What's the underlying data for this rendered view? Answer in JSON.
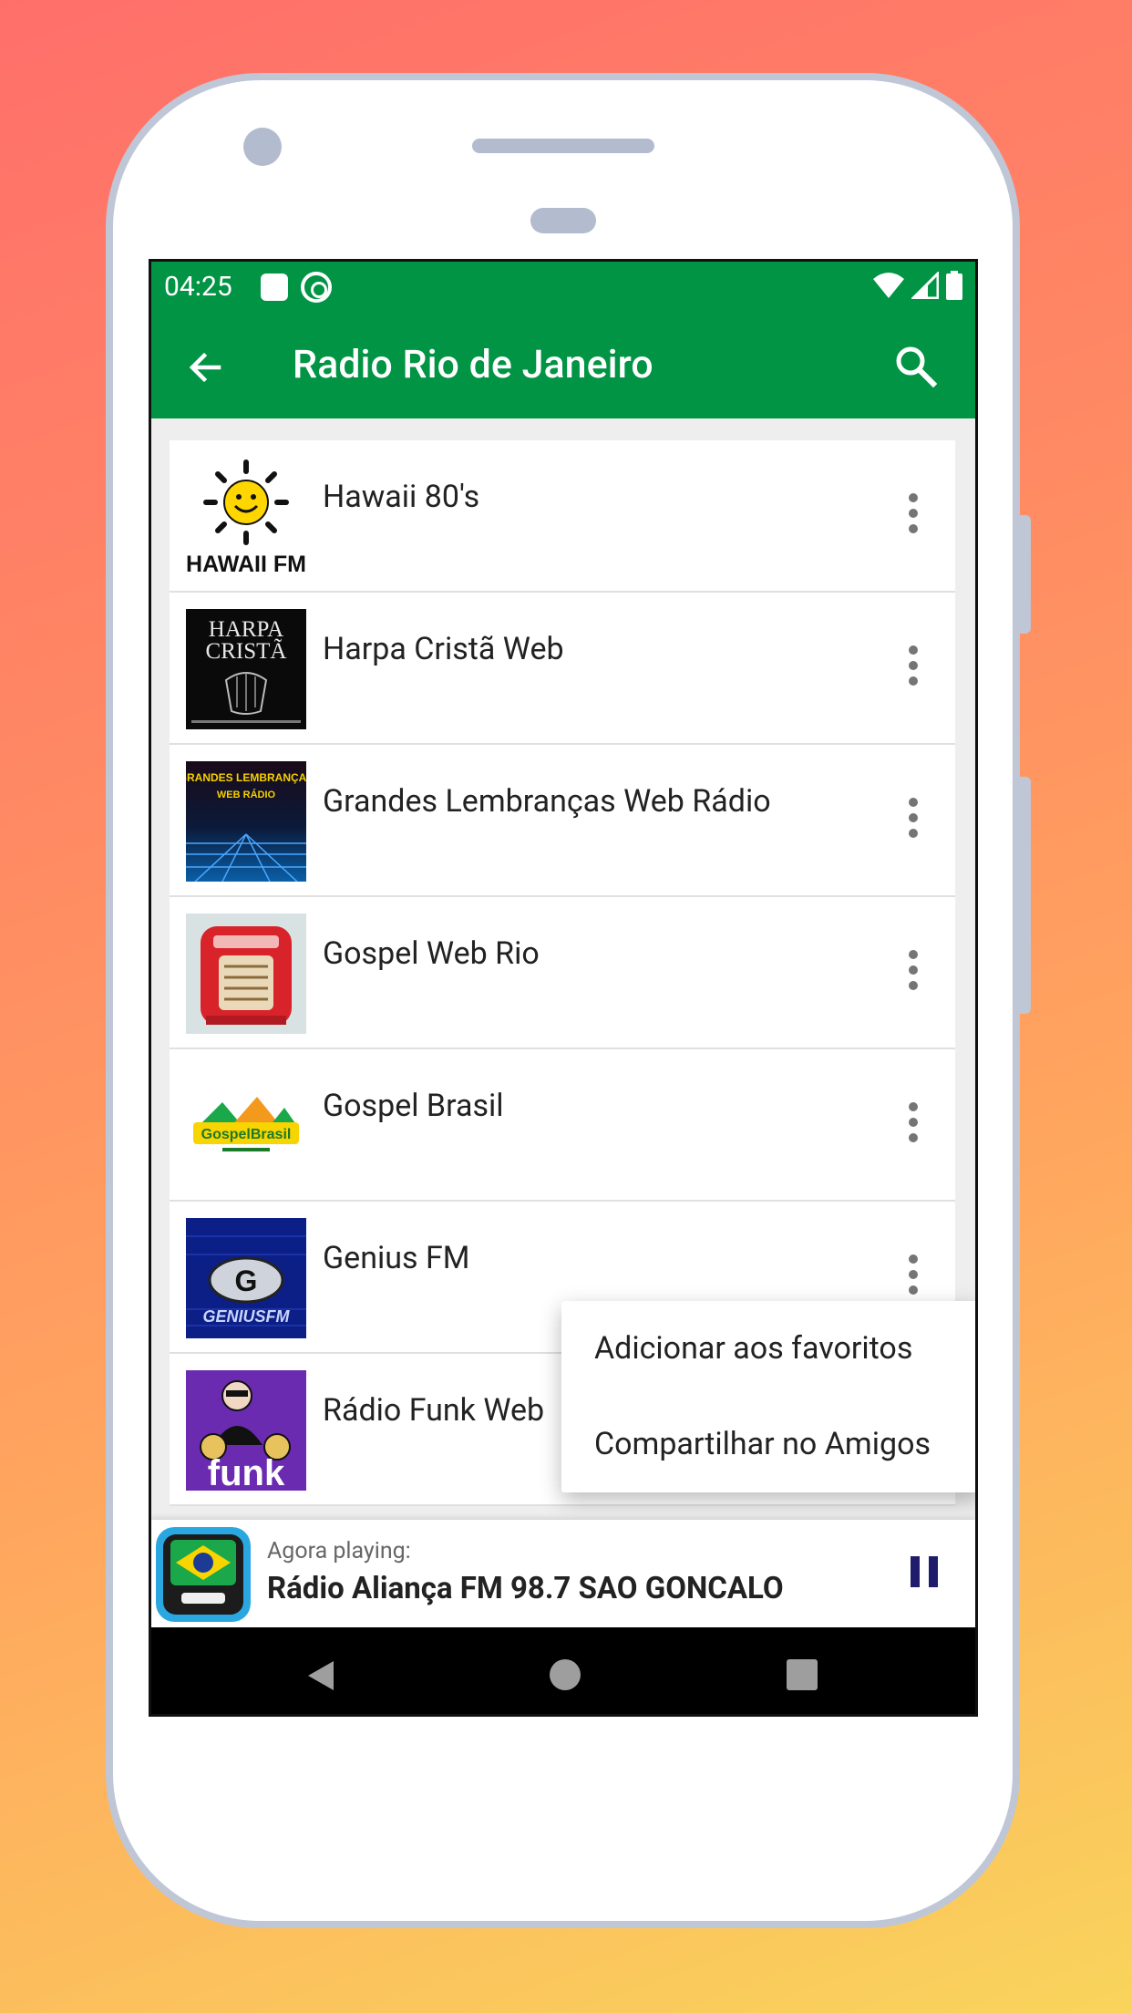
{
  "status_bar": {
    "time": "04:25"
  },
  "app_bar": {
    "title": "Radio Rio de Janeiro"
  },
  "stations": [
    {
      "name": "Hawaii 80's",
      "logo_text": "HAWAII FM"
    },
    {
      "name": "Harpa Cristã Web",
      "logo_text": "HARPA CRISTÃ"
    },
    {
      "name": "Grandes Lembranças Web Rádio",
      "logo_text": "GRANDES LEMBRANÇAS WEB RÁDIO"
    },
    {
      "name": "Gospel Web Rio",
      "logo_text": ""
    },
    {
      "name": "Gospel Brasil",
      "logo_text": "GospelBrasil"
    },
    {
      "name": "Genius FM",
      "logo_text": "GENIUSFM"
    },
    {
      "name": "Rádio Funk Web",
      "logo_text": "funk"
    }
  ],
  "context_menu": {
    "items": [
      "Adicionar aos favoritos",
      "Compartilhar no Amigos"
    ]
  },
  "now_playing": {
    "caption": "Agora playing:",
    "title": "Rádio Aliança FM 98.7 SAO GONCALO"
  },
  "colors": {
    "primary": "#009444",
    "pause": "#1f1c6b"
  }
}
